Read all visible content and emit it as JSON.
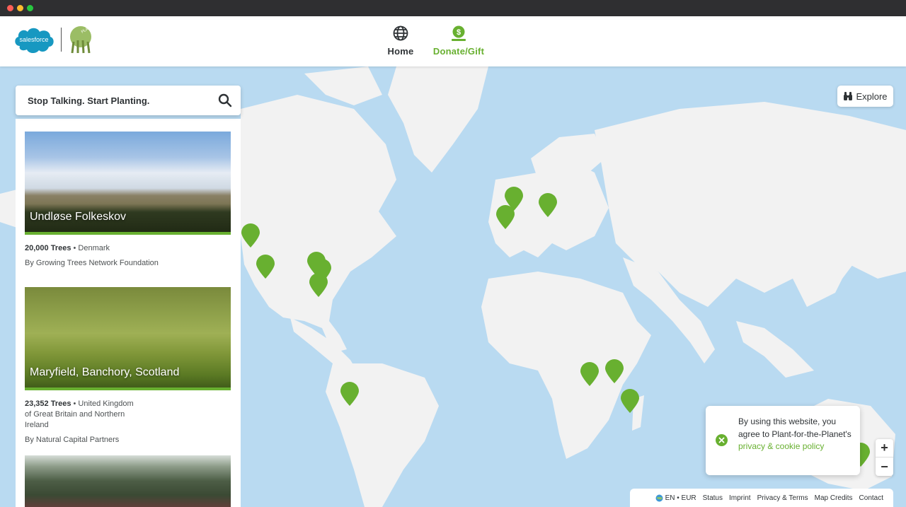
{
  "brand": {
    "salesforce": "salesforce",
    "pftp": "PLANT FOR THE PLANET"
  },
  "nav": {
    "home": "Home",
    "donate": "Donate/Gift"
  },
  "search": {
    "text": "Stop Talking. Start Planting."
  },
  "explore": "Explore",
  "projects": [
    {
      "title": "Undløse Folkeskov",
      "trees": "20,000 Trees",
      "country": "Denmark",
      "org": "By Growing Trees Network Foundation"
    },
    {
      "title": "Maryfield, Banchory, Scotland",
      "trees": "23,352 Trees",
      "country": "United Kingdom of Great Britain and Northern Ireland",
      "org": "By Natural Capital Partners"
    }
  ],
  "cookie": {
    "text": "By using this website, you agree to Plant-for-the-Planet's ",
    "link": "privacy & cookie policy"
  },
  "zoom": {
    "in": "+",
    "out": "−"
  },
  "footer": {
    "lang": "EN • EUR",
    "status": "Status",
    "imprint": "Imprint",
    "privacy": "Privacy & Terms",
    "credits": "Map Credits",
    "contact": "Contact"
  },
  "colors": {
    "accent": "#68b030",
    "ocean": "#b9daf1",
    "land": "#f2f2f2"
  }
}
